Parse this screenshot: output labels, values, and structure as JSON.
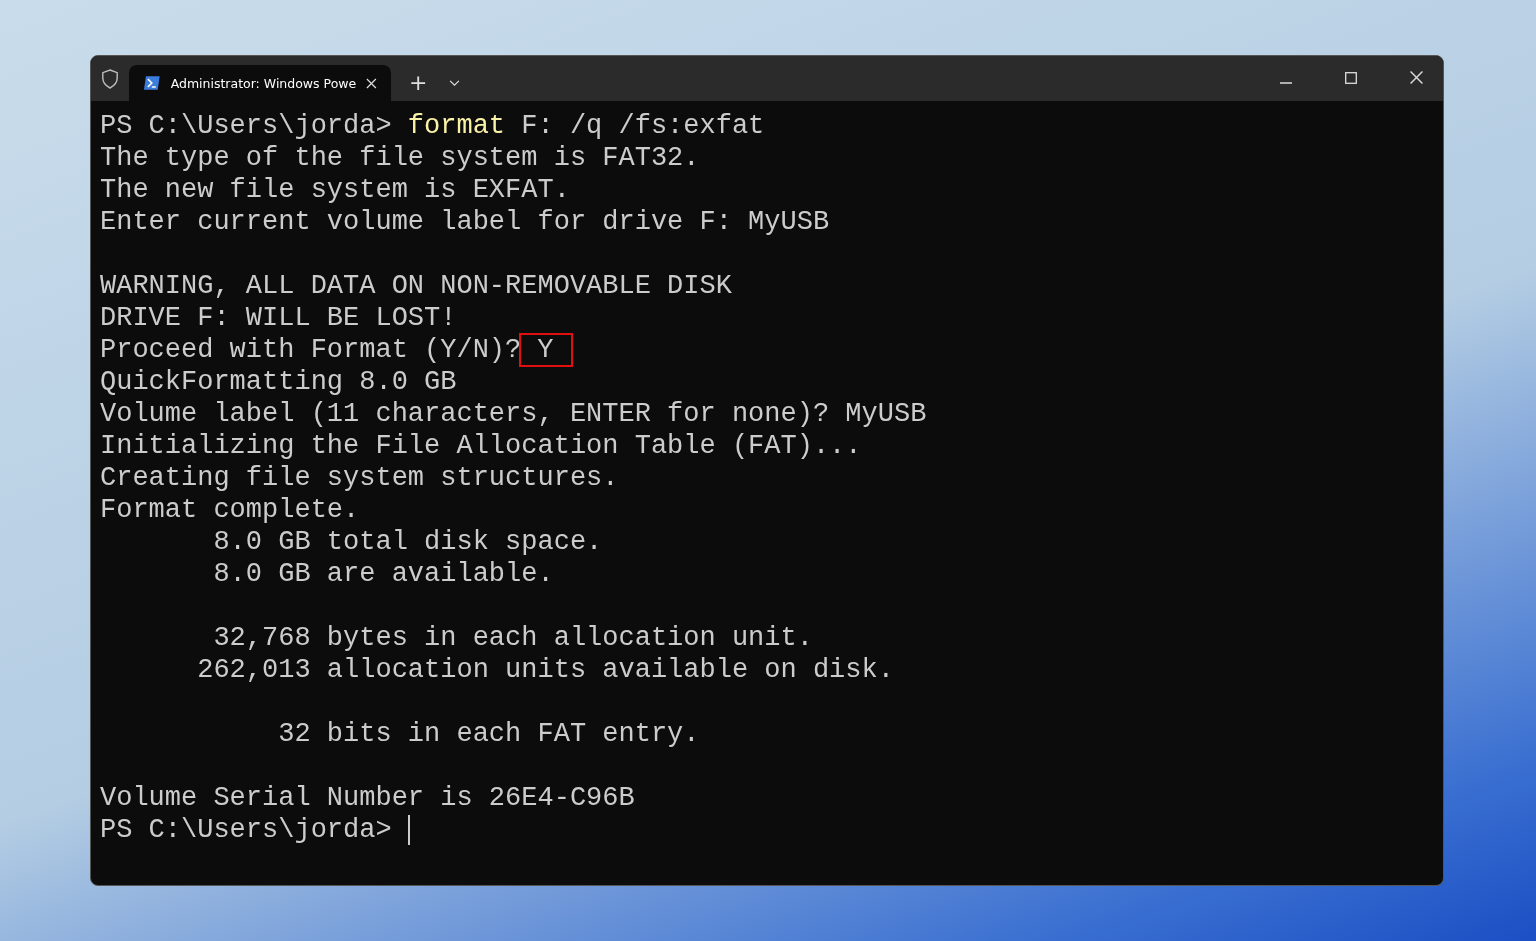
{
  "tab": {
    "title": "Administrator: Windows Powe",
    "selected": true
  },
  "new_tab_button": "+",
  "lines": [
    {
      "kind": "command",
      "prompt": "PS C:\\Users\\jorda>",
      "command": "format",
      "args": "F: /q /fs:exfat"
    },
    {
      "kind": "output",
      "text": "The type of the file system is FAT32."
    },
    {
      "kind": "output",
      "text": "The new file system is EXFAT."
    },
    {
      "kind": "output",
      "text": "Enter current volume label for drive F: MyUSB"
    },
    {
      "kind": "blank"
    },
    {
      "kind": "output",
      "text": "WARNING, ALL DATA ON NON-REMOVABLE DISK"
    },
    {
      "kind": "output",
      "text": "DRIVE F: WILL BE LOST!"
    },
    {
      "kind": "answer",
      "text": "Proceed with Format (Y/N)?",
      "answer": "Y",
      "highlighted": true
    },
    {
      "kind": "output",
      "text": "QuickFormatting 8.0 GB"
    },
    {
      "kind": "output",
      "text": "Volume label (11 characters, ENTER for none)? MyUSB"
    },
    {
      "kind": "output",
      "text": "Initializing the File Allocation Table (FAT)..."
    },
    {
      "kind": "output",
      "text": "Creating file system structures."
    },
    {
      "kind": "output",
      "text": "Format complete."
    },
    {
      "kind": "output",
      "text": "       8.0 GB total disk space."
    },
    {
      "kind": "output",
      "text": "       8.0 GB are available."
    },
    {
      "kind": "blank"
    },
    {
      "kind": "output",
      "text": "       32,768 bytes in each allocation unit."
    },
    {
      "kind": "output",
      "text": "      262,013 allocation units available on disk."
    },
    {
      "kind": "blank"
    },
    {
      "kind": "output",
      "text": "           32 bits in each FAT entry."
    },
    {
      "kind": "blank"
    },
    {
      "kind": "output",
      "text": "Volume Serial Number is 26E4-C96B"
    },
    {
      "kind": "prompt",
      "prompt": "PS C:\\Users\\jorda>",
      "cursor": true
    }
  ]
}
